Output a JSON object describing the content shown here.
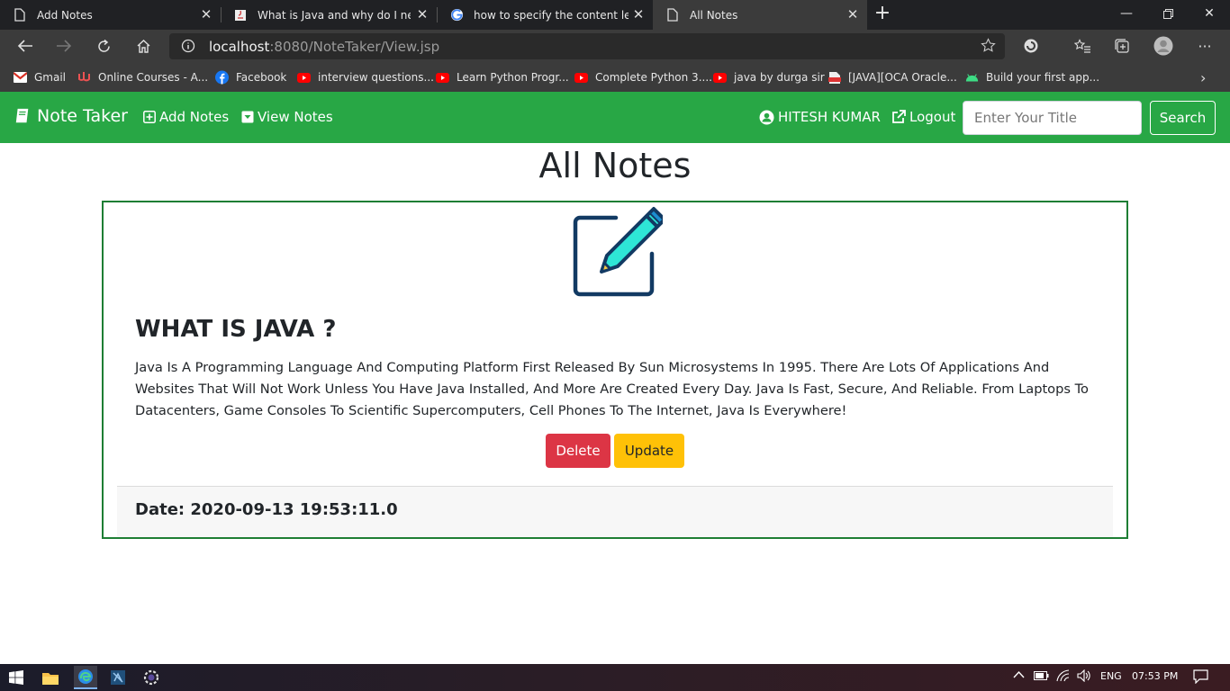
{
  "browser": {
    "tabs": [
      {
        "title": "Add Notes",
        "active": false
      },
      {
        "title": "What is Java and why do I need",
        "active": false
      },
      {
        "title": "how to specify the content lengt",
        "active": false
      },
      {
        "title": "All Notes",
        "active": true
      }
    ],
    "url_host": "localhost",
    "url_path": ":8080/NoteTaker/View.jsp",
    "bookmarks": [
      {
        "label": "Gmail",
        "icon": "gmail-icon"
      },
      {
        "label": "Online Courses - A...",
        "icon": "udemy-icon"
      },
      {
        "label": "Facebook",
        "icon": "facebook-icon"
      },
      {
        "label": "interview questions...",
        "icon": "youtube-icon"
      },
      {
        "label": "Learn Python Progr...",
        "icon": "youtube-icon"
      },
      {
        "label": "Complete Python 3....",
        "icon": "youtube-icon"
      },
      {
        "label": "java by durga sir",
        "icon": "youtube-icon"
      },
      {
        "label": "[JAVA][OCA Oracle...",
        "icon": "pdf-icon"
      },
      {
        "label": "Build your first app...",
        "icon": "android-icon"
      }
    ]
  },
  "navbar": {
    "brand": "Note Taker",
    "add_notes": "Add Notes",
    "view_notes": "View Notes",
    "user": "HITESH KUMAR",
    "logout": "Logout",
    "search_placeholder": "Enter Your Title",
    "search_button": "Search"
  },
  "page": {
    "title": "All Notes"
  },
  "note": {
    "title": "WHAT IS JAVA ?",
    "content": "Java Is A Programming Language And Computing Platform First Released By Sun Microsystems In 1995. There Are Lots Of Applications And Websites That Will Not Work Unless You Have Java Installed, And More Are Created Every Day. Java Is Fast, Secure, And Reliable. From Laptops To Datacenters, Game Consoles To Scientific Supercomputers, Cell Phones To The Internet, Java Is Everywhere!",
    "delete_label": "Delete",
    "update_label": "Update",
    "date": "Date: 2020-09-13 19:53:11.0"
  },
  "taskbar": {
    "language": "ENG",
    "time": "07:53 PM"
  },
  "colors": {
    "navbar": "#28a745",
    "card_border": "#1e7e34",
    "delete": "#dc3545",
    "update": "#ffc107"
  }
}
